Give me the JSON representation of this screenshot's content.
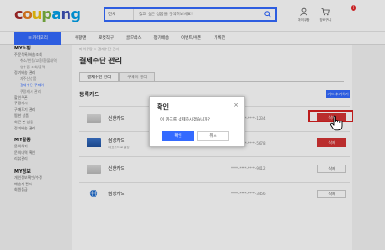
{
  "header": {
    "logo_letters": [
      "c",
      "o",
      "u",
      "p",
      "a",
      "n",
      "g"
    ],
    "search_category": "전체",
    "search_placeholder": "찾고 싶은 상품을 검색해보세요!",
    "icons": [
      {
        "name": "my-coupang-icon",
        "label": "마이쿠팡"
      },
      {
        "name": "cart-icon",
        "label": "장바구니"
      }
    ],
    "cart_count": "0"
  },
  "nav": {
    "category_label": "카테고리",
    "items": [
      "쿠팡맨",
      "로켓직구",
      "골드박스",
      "정기배송",
      "이벤트/쿠폰",
      "기획전"
    ]
  },
  "sidebar": {
    "sections": [
      {
        "title": "MY쇼핑",
        "items": [
          {
            "label": "주문목록/배송조회",
            "sub": false,
            "active": false
          },
          {
            "label": "취소/반품/교환/환불내역",
            "sub": true,
            "active": false
          },
          {
            "label": "영수증 조회/출력",
            "sub": true,
            "active": false
          },
          {
            "label": "정기배송 관리",
            "sub": false,
            "active": false
          },
          {
            "label": "자주산상품",
            "sub": true,
            "active": false
          },
          {
            "label": "결제수단·쿠페이",
            "sub": true,
            "active": true
          },
          {
            "label": "쿠팡캐시 관리",
            "sub": true,
            "active": false
          },
          {
            "label": "할인쿠폰",
            "sub": false,
            "active": false
          },
          {
            "label": "쿠팡캐시",
            "sub": false,
            "active": false
          },
          {
            "label": "구매후기 관리",
            "sub": false,
            "active": false
          },
          {
            "label": "찜한 상품",
            "sub": false,
            "active": false
          },
          {
            "label": "최근 본 상품",
            "sub": false,
            "active": false
          },
          {
            "label": "정기배송 관리",
            "sub": false,
            "active": false
          }
        ]
      },
      {
        "title": "MY활동",
        "items": [
          {
            "label": "문의하기",
            "sub": false,
            "active": false
          },
          {
            "label": "문의내역 확인",
            "sub": false,
            "active": false
          },
          {
            "label": "리뷰관리",
            "sub": false,
            "active": false
          }
        ]
      },
      {
        "title": "MY정보",
        "items": [
          {
            "label": "개인정보확인/수정",
            "sub": false,
            "active": false
          },
          {
            "label": "배송지 관리",
            "sub": false,
            "active": false
          },
          {
            "label": "회원등급",
            "sub": false,
            "active": false
          }
        ]
      }
    ]
  },
  "main": {
    "breadcrumb": "마이쿠팡 > 결제수단 관리",
    "title": "결제수단 관리",
    "tabs": [
      {
        "label": "결제수단 관리",
        "active": true
      },
      {
        "label": "쿠페이 관리",
        "active": false
      }
    ],
    "section_title": "등록카드",
    "add_button": "카드 추가하기",
    "cards": [
      {
        "name": "신한카드",
        "sub": "",
        "number": "****-****-****-1234",
        "button": "삭제",
        "button_style": "red",
        "icon": "card-grey-icon"
      },
      {
        "name": "삼성카드",
        "sub": "대표카드로 설정",
        "number": "****-****-****-5678",
        "button": "삭제",
        "button_style": "red",
        "icon": "card-blue-icon"
      },
      {
        "name": "신한카드",
        "sub": "",
        "number": "****-****-****-9012",
        "button": "삭제",
        "button_style": "grey",
        "icon": "card-grey-icon"
      },
      {
        "name": "삼성카드",
        "sub": "",
        "number": "****-****-****-3456",
        "button": "삭제",
        "button_style": "grey",
        "icon": "globe-icon"
      }
    ]
  },
  "dialog": {
    "title": "확인",
    "message": "이 카드를 삭제하시겠습니까?",
    "ok": "확인",
    "cancel": "취소"
  },
  "colors": {
    "accent": "#346aff",
    "danger": "#d43434"
  }
}
